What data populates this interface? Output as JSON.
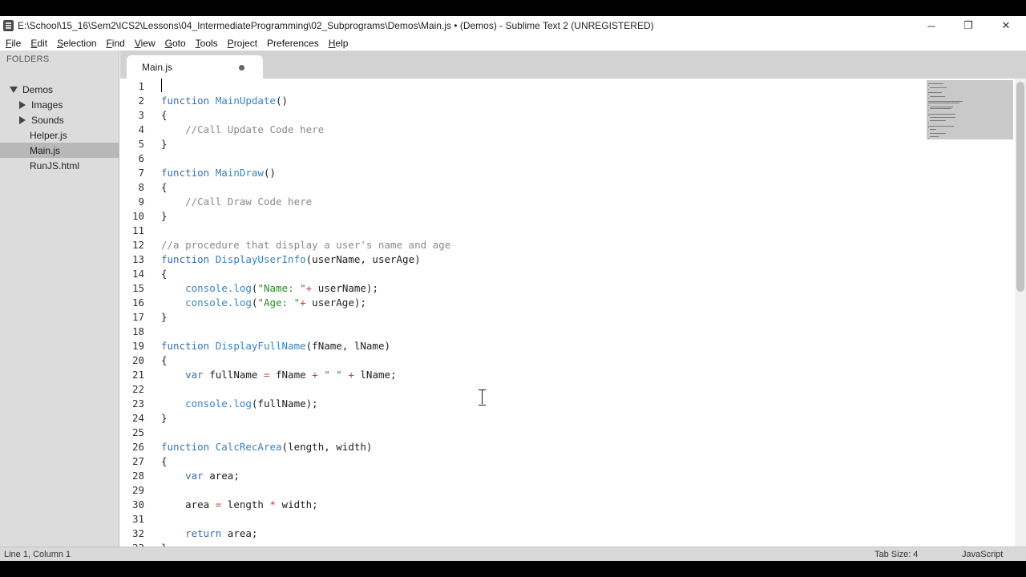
{
  "window": {
    "title": "E:\\School\\15_16\\Sem2\\ICS2\\Lessons\\04_IntermediateProgramming\\02_Subprograms\\Demos\\Main.js • (Demos) - Sublime Text 2 (UNREGISTERED)",
    "app_icon": "sublime-text-icon",
    "controls": {
      "minimize": "─",
      "restore": "❐",
      "close": "✕"
    }
  },
  "menu": [
    {
      "label": "File",
      "accel": "F",
      "rest": "ile"
    },
    {
      "label": "Edit",
      "accel": "E",
      "rest": "dit"
    },
    {
      "label": "Selection",
      "accel": "S",
      "rest": "election"
    },
    {
      "label": "Find",
      "accel": "F",
      "rest": "ind"
    },
    {
      "label": "View",
      "accel": "V",
      "rest": "iew"
    },
    {
      "label": "Goto",
      "accel": "G",
      "rest": "oto"
    },
    {
      "label": "Tools",
      "accel": "T",
      "rest": "ools"
    },
    {
      "label": "Project",
      "accel": "P",
      "rest": "roject"
    },
    {
      "label": "Preferences",
      "accel": "",
      "rest": "Preferences"
    },
    {
      "label": "Help",
      "accel": "H",
      "rest": "elp"
    }
  ],
  "sidebar": {
    "header": "FOLDERS",
    "items": [
      {
        "label": "Demos",
        "type": "folder-open",
        "indent": 1
      },
      {
        "label": "Images",
        "type": "folder-closed",
        "indent": 2
      },
      {
        "label": "Sounds",
        "type": "folder-closed",
        "indent": 2
      },
      {
        "label": "Helper.js",
        "type": "file",
        "indent": 2
      },
      {
        "label": "Main.js",
        "type": "file",
        "indent": 2,
        "selected": true
      },
      {
        "label": "RunJS.html",
        "type": "file",
        "indent": 2
      }
    ]
  },
  "tabs": [
    {
      "label": "Main.js",
      "modified": true
    }
  ],
  "editor": {
    "lines": [
      "",
      "function MainUpdate()",
      "{",
      "    //Call Update Code here",
      "}",
      "",
      "function MainDraw()",
      "{",
      "    //Call Draw Code here",
      "}",
      "",
      "//a procedure that display a user's name and age",
      "function DisplayUserInfo(userName, userAge)",
      "{",
      "    console.log(\"Name: \"+ userName);",
      "    console.log(\"Age: \"+ userAge);",
      "}",
      "",
      "function DisplayFullName(fName, lName)",
      "{",
      "    var fullName = fName + \" \" + lName;",
      "",
      "    console.log(fullName);",
      "}",
      "",
      "function CalcRecArea(length, width)",
      "{",
      "    var area;",
      "",
      "    area = length * width;",
      "",
      "    return area;",
      "}"
    ]
  },
  "colors": {
    "keyword": "#3b6ea5",
    "function_name": "#3f83b7",
    "comment": "#8a8a8a",
    "string": "#2f8a2f",
    "operator": "#b04a3a"
  },
  "status": {
    "position": "Line 1, Column 1",
    "tab_size": "Tab Size: 4",
    "syntax": "JavaScript"
  }
}
